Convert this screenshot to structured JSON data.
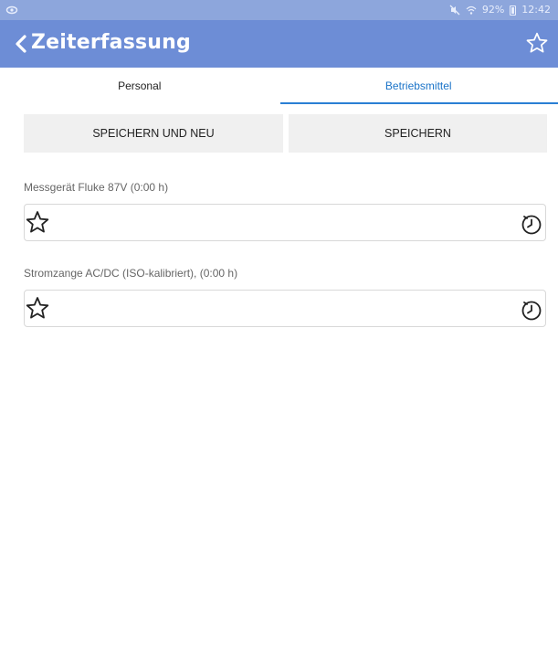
{
  "status_bar": {
    "battery_text": "92%",
    "time": "12:42",
    "icons": [
      "eye-icon",
      "mute-icon",
      "wifi-icon",
      "battery-icon"
    ]
  },
  "header": {
    "title": "Zeiterfassung",
    "back_icon": "chevron-left-icon",
    "favorite_icon": "star-outline-icon",
    "background_color": "#6d8dd6"
  },
  "tabs": [
    {
      "label": "Personal",
      "active": false
    },
    {
      "label": "Betriebsmittel",
      "active": true
    }
  ],
  "accent_color": "#2a7fd4",
  "actions": {
    "save_new_label": "SPEICHERN UND NEU",
    "save_label": "SPEICHERN"
  },
  "items": [
    {
      "label": "Messgerät Fluke 87V (0:00 h)",
      "favorite_icon": "star-outline-icon",
      "time_icon": "clock-icon"
    },
    {
      "label": "Stromzange AC/DC (ISO-kalibriert), (0:00 h)",
      "favorite_icon": "star-outline-icon",
      "time_icon": "clock-icon"
    }
  ]
}
